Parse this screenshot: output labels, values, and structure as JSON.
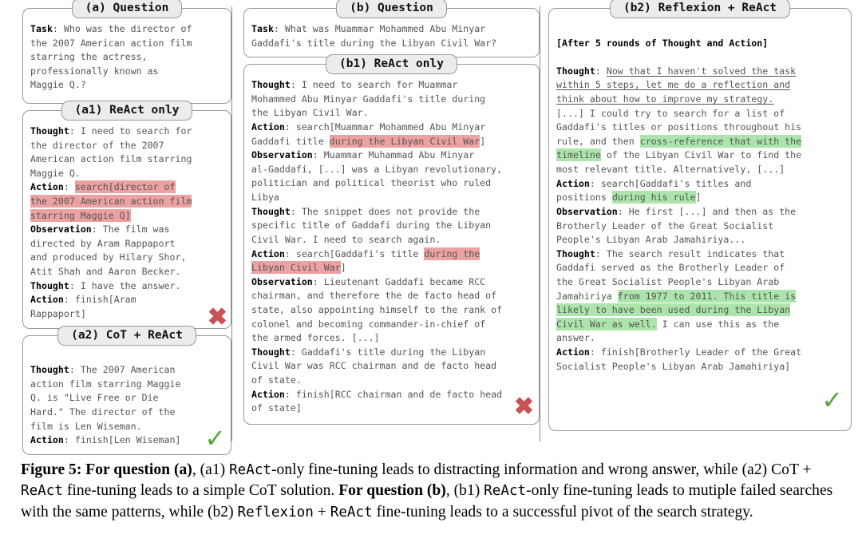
{
  "figure": {
    "caption_label": "Figure 5:",
    "caption_parts": [
      {
        "t": " ",
        "style": "plain"
      },
      {
        "t": "For question (a)",
        "style": "bold"
      },
      {
        "t": ", (a1) ",
        "style": "plain"
      },
      {
        "t": "ReAct",
        "style": "mono"
      },
      {
        "t": "-only fine-tuning leads to distracting information and wrong answer, while (a2) CoT + ",
        "style": "plain"
      },
      {
        "t": "ReAct",
        "style": "mono"
      },
      {
        "t": " fine-tuning leads to a simple CoT solution.  ",
        "style": "plain"
      },
      {
        "t": "For question (b)",
        "style": "bold"
      },
      {
        "t": ", (b1) ",
        "style": "plain"
      },
      {
        "t": "ReAct",
        "style": "mono"
      },
      {
        "t": "-only fine-tuning leads to mutiple failed searches with the same patterns, while (b2) ",
        "style": "plain"
      },
      {
        "t": "Reflexion",
        "style": "mono"
      },
      {
        "t": " + ",
        "style": "plain"
      },
      {
        "t": "ReAct",
        "style": "mono"
      },
      {
        "t": " fine-tuning leads to a successful pivot of the search strategy.",
        "style": "plain"
      }
    ]
  },
  "colors": {
    "highlight_red": "#eda2a2",
    "highlight_green": "#ace5ac",
    "cross_red": "#c75454",
    "check_green": "#55a839",
    "panel_border": "#9a9a9a",
    "title_fill": "#ececec",
    "body_text": "#555555",
    "label_text": "#000000"
  },
  "panels": {
    "a_question": {
      "title": "(a) Question",
      "lines": [
        [
          {
            "t": "Task",
            "style": "label"
          },
          {
            "t": ": Who was the director of",
            "style": "plain"
          }
        ],
        [
          {
            "t": "the 2007 American action film",
            "style": "plain"
          }
        ],
        [
          {
            "t": "starring the actress,",
            "style": "plain"
          }
        ],
        [
          {
            "t": "professionally known as",
            "style": "plain"
          }
        ],
        [
          {
            "t": "Maggie Q.?",
            "style": "plain"
          }
        ]
      ]
    },
    "a1_react_only": {
      "title": "(a1) ReAct only",
      "verdict": "cross",
      "lines": [
        [
          {
            "t": "Thought",
            "style": "label"
          },
          {
            "t": ": I need to search for",
            "style": "plain"
          }
        ],
        [
          {
            "t": "the director of the 2007",
            "style": "plain"
          }
        ],
        [
          {
            "t": "American action film starring",
            "style": "plain"
          }
        ],
        [
          {
            "t": "Maggie Q.",
            "style": "plain"
          }
        ],
        [
          {
            "t": "Action",
            "style": "label"
          },
          {
            "t": ": ",
            "style": "plain"
          },
          {
            "t": "search[director of",
            "style": "red"
          }
        ],
        [
          {
            "t": "the 2007 American action film",
            "style": "red"
          }
        ],
        [
          {
            "t": "starring Maggie Q]",
            "style": "red"
          }
        ],
        [
          {
            "t": "Observation",
            "style": "label"
          },
          {
            "t": ": The film was",
            "style": "plain"
          }
        ],
        [
          {
            "t": "directed by Aram Rappaport",
            "style": "plain"
          }
        ],
        [
          {
            "t": "and produced by Hilary Shor,",
            "style": "plain"
          }
        ],
        [
          {
            "t": "Atit Shah and Aaron Becker.",
            "style": "plain"
          }
        ],
        [
          {
            "t": "Thought",
            "style": "label"
          },
          {
            "t": ": I have the answer.",
            "style": "plain"
          }
        ],
        [
          {
            "t": "Action",
            "style": "label"
          },
          {
            "t": ": finish[Aram",
            "style": "plain"
          }
        ],
        [
          {
            "t": "Rappaport]",
            "style": "plain"
          }
        ]
      ]
    },
    "a2_cot_react": {
      "title": "(a2) CoT + ReAct",
      "verdict": "check",
      "lines": [
        [
          {
            "t": "",
            "style": "plain"
          }
        ],
        [
          {
            "t": "Thought",
            "style": "label"
          },
          {
            "t": ": The 2007 American",
            "style": "plain"
          }
        ],
        [
          {
            "t": "action film starring Maggie",
            "style": "plain"
          }
        ],
        [
          {
            "t": "Q. is \"Live Free or Die",
            "style": "plain"
          }
        ],
        [
          {
            "t": "Hard.\" The director of the",
            "style": "plain"
          }
        ],
        [
          {
            "t": "film is Len Wiseman.",
            "style": "plain"
          }
        ],
        [
          {
            "t": "Action",
            "style": "label"
          },
          {
            "t": ": finish[Len Wiseman]",
            "style": "plain"
          }
        ]
      ]
    },
    "b_question": {
      "title": "(b) Question",
      "lines": [
        [
          {
            "t": "Task",
            "style": "label"
          },
          {
            "t": ": What was Muammar Mohammed Abu Minyar",
            "style": "plain"
          }
        ],
        [
          {
            "t": "Gaddafi's title during the Libyan Civil War?",
            "style": "plain"
          }
        ]
      ]
    },
    "b1_react_only": {
      "title": "(b1) ReAct only",
      "verdict": "cross",
      "lines": [
        [
          {
            "t": "Thought",
            "style": "label"
          },
          {
            "t": ": I need to search for Muammar",
            "style": "plain"
          }
        ],
        [
          {
            "t": "Mohammed Abu Minyar Gaddafi's title during",
            "style": "plain"
          }
        ],
        [
          {
            "t": "the Libyan Civil War.",
            "style": "plain"
          }
        ],
        [
          {
            "t": "Action",
            "style": "label"
          },
          {
            "t": ": search[Muammar Mohammed Abu Minyar",
            "style": "plain"
          }
        ],
        [
          {
            "t": "Gaddafi title ",
            "style": "plain"
          },
          {
            "t": "during the Libyan Civil War",
            "style": "red"
          },
          {
            "t": "]",
            "style": "plain"
          }
        ],
        [
          {
            "t": "Observation",
            "style": "label"
          },
          {
            "t": ": Muammar Muhammad Abu Minyar",
            "style": "plain"
          }
        ],
        [
          {
            "t": "al-Gaddafi, [...] was a Libyan revolutionary,",
            "style": "plain"
          }
        ],
        [
          {
            "t": "politician and political theorist who ruled",
            "style": "plain"
          }
        ],
        [
          {
            "t": "Libya",
            "style": "plain"
          }
        ],
        [
          {
            "t": "Thought",
            "style": "label"
          },
          {
            "t": ": The snippet does not provide the",
            "style": "plain"
          }
        ],
        [
          {
            "t": "specific title of Gaddafi during the Libyan",
            "style": "plain"
          }
        ],
        [
          {
            "t": "Civil War. I need to search again.",
            "style": "plain"
          }
        ],
        [
          {
            "t": "Action",
            "style": "label"
          },
          {
            "t": ": search[Gaddafi's title ",
            "style": "plain"
          },
          {
            "t": "during the",
            "style": "red"
          }
        ],
        [
          {
            "t": "Libyan Civil War",
            "style": "red"
          },
          {
            "t": "]",
            "style": "plain"
          }
        ],
        [
          {
            "t": "Observation",
            "style": "label"
          },
          {
            "t": ": Lieutenant Gaddafi became RCC",
            "style": "plain"
          }
        ],
        [
          {
            "t": "chairman, and therefore the de facto head of",
            "style": "plain"
          }
        ],
        [
          {
            "t": "state, also appointing himself to the rank of",
            "style": "plain"
          }
        ],
        [
          {
            "t": "colonel and becoming commander-in-chief of",
            "style": "plain"
          }
        ],
        [
          {
            "t": "the armed forces. [...]",
            "style": "plain"
          }
        ],
        [
          {
            "t": "Thought",
            "style": "label"
          },
          {
            "t": ": Gaddafi's title during the Libyan",
            "style": "plain"
          }
        ],
        [
          {
            "t": "Civil War was RCC chairman and de facto head",
            "style": "plain"
          }
        ],
        [
          {
            "t": "of state.",
            "style": "plain"
          }
        ],
        [
          {
            "t": "Action",
            "style": "label"
          },
          {
            "t": ": finish[RCC chairman and de facto head",
            "style": "plain"
          }
        ],
        [
          {
            "t": "of state]",
            "style": "plain"
          }
        ]
      ]
    },
    "b2_reflexion_react": {
      "title": "(b2) Reflexion + ReAct",
      "verdict": "check",
      "lines": [
        [
          {
            "t": "",
            "style": "plain"
          }
        ],
        [
          {
            "t": "[After 5 rounds of Thought and Action]",
            "style": "label"
          }
        ],
        [
          {
            "t": "",
            "style": "plain"
          }
        ],
        [
          {
            "t": "Thought",
            "style": "label"
          },
          {
            "t": ": ",
            "style": "plain"
          },
          {
            "t": "Now that I haven't solved the task",
            "style": "underline"
          }
        ],
        [
          {
            "t": "within 5 steps, let me do a reflection and",
            "style": "underline"
          }
        ],
        [
          {
            "t": "think about how to improve my strategy.",
            "style": "underline"
          }
        ],
        [
          {
            "t": "[...] I could try to search for a list of",
            "style": "plain"
          }
        ],
        [
          {
            "t": "Gaddafi's titles or positions throughout his",
            "style": "plain"
          }
        ],
        [
          {
            "t": "rule, and then ",
            "style": "plain"
          },
          {
            "t": "cross-reference that with the",
            "style": "green"
          }
        ],
        [
          {
            "t": "timeline",
            "style": "green"
          },
          {
            "t": " of the Libyan Civil War to find the",
            "style": "plain"
          }
        ],
        [
          {
            "t": "most relevant title. Alternatively, [...]",
            "style": "plain"
          }
        ],
        [
          {
            "t": "Action",
            "style": "label"
          },
          {
            "t": ": search[Gaddafi's titles and",
            "style": "plain"
          }
        ],
        [
          {
            "t": "positions ",
            "style": "plain"
          },
          {
            "t": "during his rule",
            "style": "green"
          },
          {
            "t": "]",
            "style": "plain"
          }
        ],
        [
          {
            "t": "Observation",
            "style": "label"
          },
          {
            "t": ": He first [...] and then as the",
            "style": "plain"
          }
        ],
        [
          {
            "t": "Brotherly Leader of the Great Socialist",
            "style": "plain"
          }
        ],
        [
          {
            "t": "People's Libyan Arab Jamahiriya...",
            "style": "plain"
          }
        ],
        [
          {
            "t": "Thought",
            "style": "label"
          },
          {
            "t": ": The search result indicates that",
            "style": "plain"
          }
        ],
        [
          {
            "t": "Gaddafi served as the Brotherly Leader of",
            "style": "plain"
          }
        ],
        [
          {
            "t": "the Great Socialist People's Libyan Arab",
            "style": "plain"
          }
        ],
        [
          {
            "t": "Jamahiriya ",
            "style": "plain"
          },
          {
            "t": "from 1977 to 2011. This title is",
            "style": "green"
          }
        ],
        [
          {
            "t": "likely to have been used during the Libyan",
            "style": "green"
          }
        ],
        [
          {
            "t": "Civil War as well.",
            "style": "green"
          },
          {
            "t": " I can use this as the",
            "style": "plain"
          }
        ],
        [
          {
            "t": "answer.",
            "style": "plain"
          }
        ],
        [
          {
            "t": "Action",
            "style": "label"
          },
          {
            "t": ": finish[Brotherly Leader of the Great",
            "style": "plain"
          }
        ],
        [
          {
            "t": "Socialist People's Libyan Arab Jamahiriya]",
            "style": "plain"
          }
        ]
      ]
    }
  }
}
